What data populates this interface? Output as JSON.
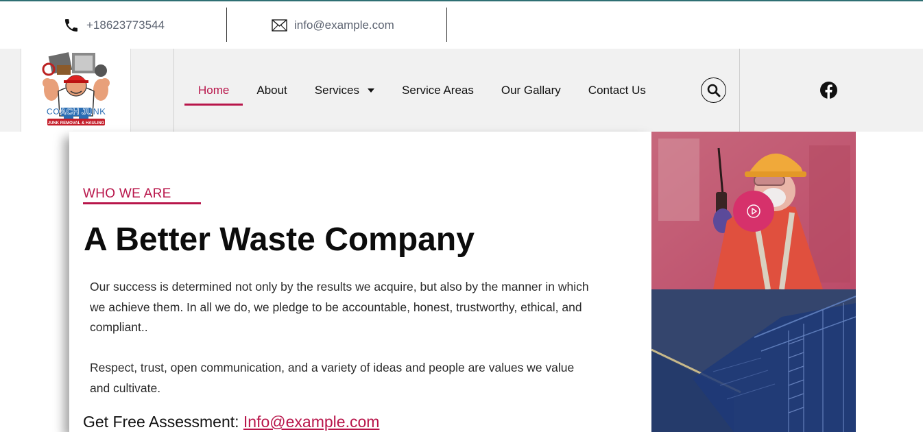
{
  "contact": {
    "phone": "+18623773544",
    "email": "info@example.com",
    "phone_icon": "phone-icon",
    "email_icon": "envelope-icon"
  },
  "nav": {
    "logo_alt": "Coach Junk - Junk Removal & Hauling",
    "items": [
      {
        "label": "Home",
        "active": true
      },
      {
        "label": "About"
      },
      {
        "label": "Services",
        "has_dropdown": true
      },
      {
        "label": "Service Areas"
      },
      {
        "label": "Our Gallary"
      },
      {
        "label": "Contact Us"
      }
    ],
    "search_icon": "search-icon",
    "social_icon": "facebook-icon"
  },
  "content": {
    "eyebrow": "WHO WE ARE",
    "headline": "A Better Waste Company",
    "paragraph1": "Our success is determined not only by the results we acquire, but also by the manner in which we achieve them. In all we do, we pledge to be accountable, honest, trustworthy, ethical, and compliant..",
    "paragraph2": "Respect, trust, open communication, and a variety of ideas and people are values we value and cultivate.",
    "assessment_label": "Get Free Assessment:",
    "assessment_link": "Info@example.com"
  },
  "media": {
    "play_icon": "play-icon"
  },
  "colors": {
    "accent": "#b8154a",
    "nav_bg": "#f1f1f1",
    "play_button": "#d6316b",
    "overlay_blue": "#2e3f66"
  }
}
